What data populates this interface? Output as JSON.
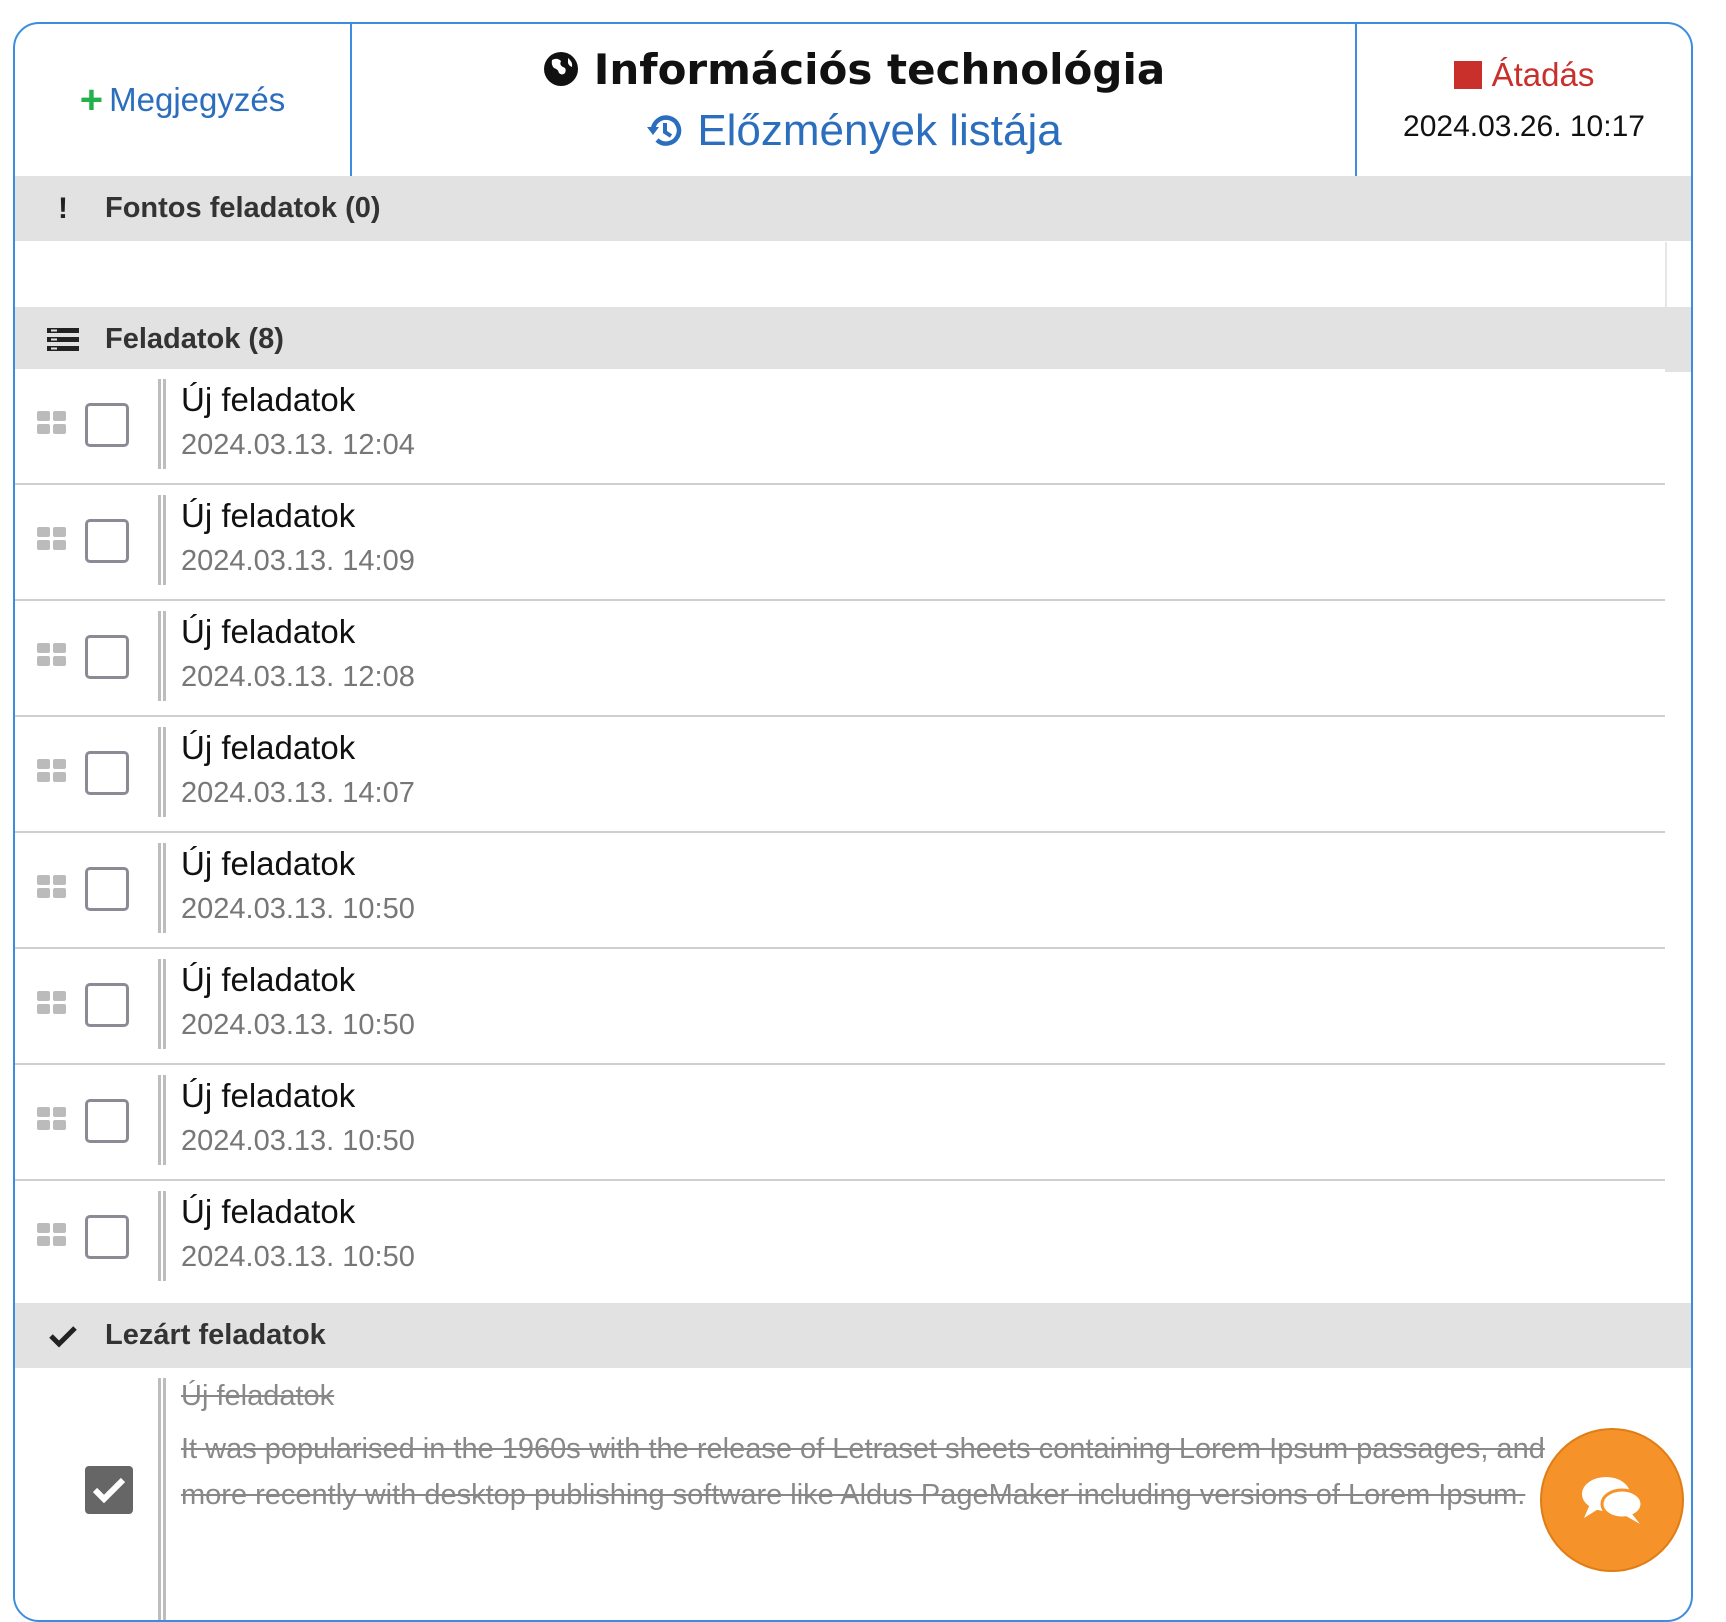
{
  "header": {
    "add_note_label": "Megjegyzés",
    "title": "Információs technológia",
    "history_label": "Előzmények listája",
    "handover_label": "Átadás",
    "handover_date": "2024.03.26. 10:17"
  },
  "sections": {
    "important": {
      "label": "Fontos feladatok (0)"
    },
    "tasks": {
      "label": "Feladatok (8)"
    },
    "closed": {
      "label": "Lezárt feladatok"
    }
  },
  "tasks": [
    {
      "title": "Új feladatok",
      "date": "2024.03.13. 12:04"
    },
    {
      "title": "Új feladatok",
      "date": "2024.03.13. 14:09"
    },
    {
      "title": "Új feladatok",
      "date": "2024.03.13. 12:08"
    },
    {
      "title": "Új feladatok",
      "date": "2024.03.13. 14:07"
    },
    {
      "title": "Új feladatok",
      "date": "2024.03.13. 10:50"
    },
    {
      "title": "Új feladatok",
      "date": "2024.03.13. 10:50"
    },
    {
      "title": "Új feladatok",
      "date": "2024.03.13. 10:50"
    },
    {
      "title": "Új feladatok",
      "date": "2024.03.13. 10:50"
    }
  ],
  "closed_tasks": [
    {
      "title": "Új feladatok",
      "description": "It was popularised in the 1960s with the release of Letraset sheets containing Lorem Ipsum passages, and more recently with desktop publishing software like Aldus PageMaker including versions of Lorem Ipsum."
    }
  ],
  "colors": {
    "accent": "#3c8dde",
    "link": "#2a6ebd",
    "add_green": "#22b14c",
    "handover_red": "#c9302c",
    "chat_orange": "#f5922a"
  }
}
